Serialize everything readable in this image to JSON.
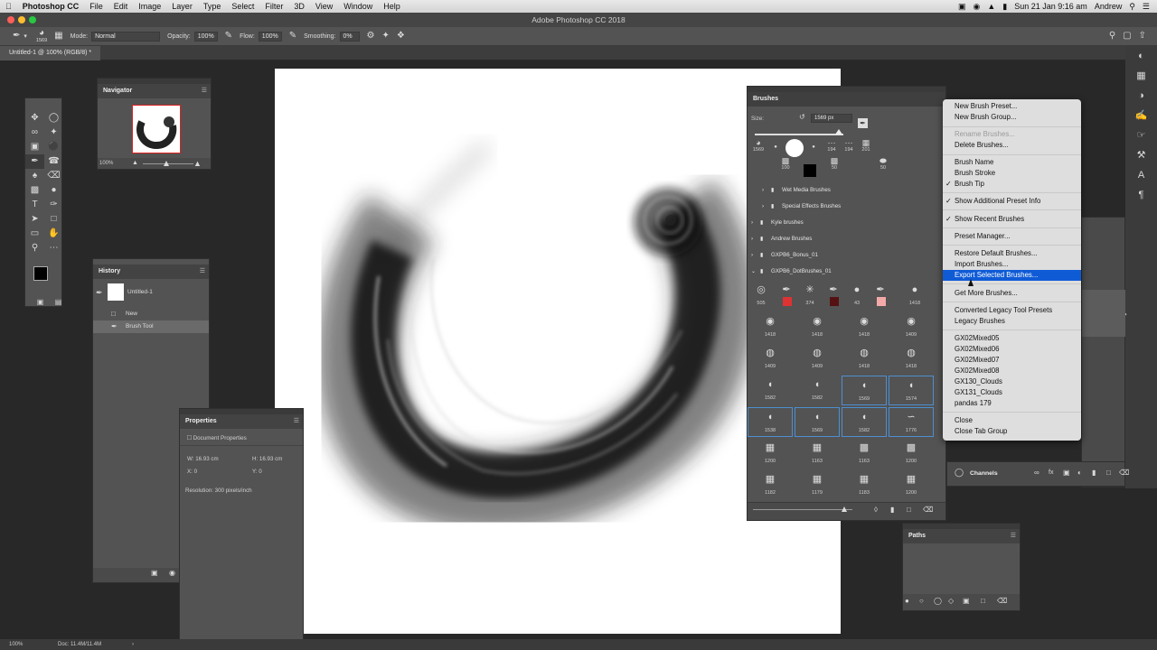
{
  "menubar": {
    "app": "Photoshop CC",
    "items": [
      "File",
      "Edit",
      "Image",
      "Layer",
      "Type",
      "Select",
      "Filter",
      "3D",
      "View",
      "Window",
      "Help"
    ],
    "clock": "Sun 21 Jan  9:16 am",
    "user": "Andrew"
  },
  "window_title": "Adobe Photoshop CC 2018",
  "options": {
    "brush_size": "1569",
    "mode_label": "Mode:",
    "mode_value": "Normal",
    "opacity_label": "Opacity:",
    "opacity_value": "100%",
    "flow_label": "Flow:",
    "flow_value": "100%",
    "smoothing_label": "Smoothing:",
    "smoothing_value": "0%"
  },
  "document_tab": "Untitled-1 @ 100% (RGB/8) *",
  "navigator": {
    "title": "Navigator",
    "zoom": "100%"
  },
  "history": {
    "title": "History",
    "snapshot": "Untitled-1",
    "items": [
      "New",
      "Brush Tool"
    ]
  },
  "properties": {
    "title": "Properties",
    "subtitle": "Document Properties",
    "w_label": "W:",
    "w_value": "16.93 cm",
    "h_label": "H:",
    "h_value": "16.93 cm",
    "x_label": "X:",
    "x_value": "0",
    "y_label": "Y:",
    "y_value": "0",
    "resolution": "Resolution: 300 pixels/inch"
  },
  "brushes": {
    "title": "Brushes",
    "size_label": "Size:",
    "size_value": "1569 px",
    "recent": [
      "1569",
      "",
      "",
      "194",
      "194",
      "201"
    ],
    "row2": [
      "100",
      "",
      "50",
      "",
      "50"
    ],
    "folders": [
      "Wet Media Brushes",
      "Special Effects Brushes",
      "Kyle brushes",
      "Andrew Brushes",
      "GXPB6_Bonus_01",
      "GXPB6_DotBrushes_01"
    ],
    "grid": [
      [
        "505",
        "",
        "374",
        "",
        "43",
        "",
        "1418"
      ],
      [
        "1418",
        "1418",
        "1418",
        "1409"
      ],
      [
        "1409",
        "1409",
        "1418",
        "1418"
      ],
      [
        "1582",
        "1582",
        "1569",
        "1574"
      ],
      [
        "1538",
        "1569",
        "1582",
        "1776"
      ],
      [
        "1200",
        "1163",
        "1163",
        "1200"
      ],
      [
        "1182",
        "1179",
        "1183",
        "1200"
      ]
    ]
  },
  "dropdown": {
    "items": [
      "New Brush Preset...",
      "New Brush Group...",
      "Rename Brushes...",
      "Delete Brushes...",
      "Brush Name",
      "Brush Stroke",
      "Brush Tip",
      "Show Additional Preset Info",
      "Show Recent Brushes",
      "Preset Manager...",
      "Restore Default Brushes...",
      "Import Brushes...",
      "Export Selected Brushes...",
      "Get More Brushes...",
      "Converted Legacy Tool Presets",
      "Legacy Brushes",
      "GX02Mixed05",
      "GX02Mixed06",
      "GX02Mixed07",
      "GX02Mixed08",
      "GX130_Clouds",
      "GX131_Clouds",
      "pandas 179",
      "Close",
      "Close Tab Group"
    ]
  },
  "channels": {
    "title": "Channels"
  },
  "paths": {
    "title": "Paths"
  },
  "status": {
    "zoom": "100%",
    "doc": "Doc: 11.4M/11.4M"
  },
  "colors": {
    "accent": "#0f5bd6",
    "panel": "#535353",
    "selection": "#4d8fd1"
  }
}
